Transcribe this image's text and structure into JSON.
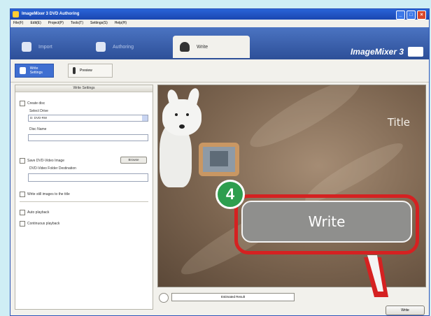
{
  "window": {
    "title": "ImageMixer 3 DVD Authoring",
    "controls": [
      "_",
      "□",
      "×"
    ]
  },
  "menu": [
    "File(F)",
    "Edit(E)",
    "Project(P)",
    "Tools(T)",
    "Settings(S)",
    "Help(H)"
  ],
  "main_tabs": [
    {
      "label": "Import",
      "icon": "import-icon"
    },
    {
      "label": "Authoring",
      "icon": "authoring-icon"
    },
    {
      "label": "Write",
      "icon": "write-icon"
    }
  ],
  "brand": "ImageMixer 3",
  "sub_tabs": [
    {
      "label": "Write Settings",
      "icon": "write-settings-icon"
    },
    {
      "label": "Preview",
      "icon": "preview-icon"
    }
  ],
  "settings": {
    "header": "Write Settings",
    "create_disc": "Create disc",
    "select_drive": "Select Drive",
    "drive_value": "D: DVD-RW",
    "disc_name": "Disc Name",
    "save_dvd_video": "Save DVD-Video Image",
    "browse": "Browse",
    "dvd_video_dest": "DVD-Video Folder Destination",
    "write_still": "Write still images to the title",
    "auto_playback": "Auto playback",
    "continuous_playback": "Continuous playback"
  },
  "preview": {
    "title": "Title",
    "callout_number": "4",
    "callout_label": "Write"
  },
  "bottom": {
    "estimate": "Estimated Result",
    "write_button": "Write"
  },
  "colors": {
    "callout_green": "#2e9e4e",
    "callout_red": "#d52121",
    "toolbar_blue": "#2d4f98"
  }
}
